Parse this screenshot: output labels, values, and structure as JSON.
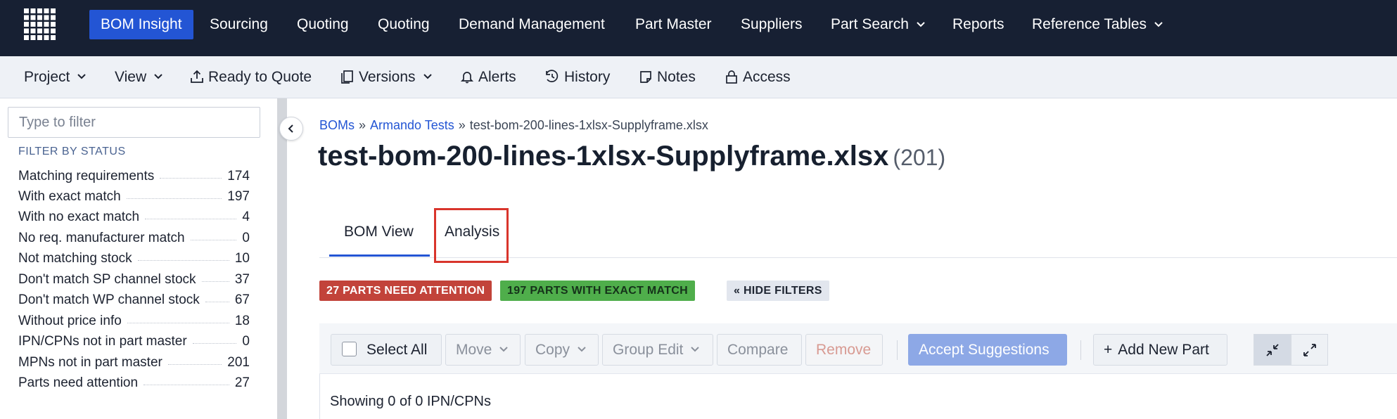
{
  "topnav": {
    "items": [
      {
        "label": "BOM Insight"
      },
      {
        "label": "Sourcing"
      },
      {
        "label": "Quoting"
      },
      {
        "label": "Quoting"
      },
      {
        "label": "Demand Management"
      },
      {
        "label": "Part Master"
      },
      {
        "label": "Suppliers"
      },
      {
        "label": "Part Search"
      },
      {
        "label": "Reports"
      },
      {
        "label": "Reference Tables"
      }
    ],
    "active_index": 0,
    "colors": {
      "bar": "#172033",
      "active": "#2355d4"
    }
  },
  "subbar": {
    "items": [
      {
        "label": "Project",
        "icon": "chevron-down-icon"
      },
      {
        "label": "View",
        "icon": "chevron-down-icon"
      },
      {
        "label": "Ready to Quote",
        "icon": "upload-icon"
      },
      {
        "label": "Versions",
        "icon": "versions-icon"
      },
      {
        "label": "Alerts",
        "icon": "bell-icon"
      },
      {
        "label": "History",
        "icon": "history-icon"
      },
      {
        "label": "Notes",
        "icon": "note-icon"
      },
      {
        "label": "Access",
        "icon": "lock-icon"
      }
    ]
  },
  "sidebar": {
    "filter_placeholder": "Type to filter",
    "filter_value": "",
    "heading": "FILTER BY STATUS",
    "statuses": [
      {
        "label": "Matching requirements",
        "count": "174"
      },
      {
        "label": "With exact match",
        "count": "197"
      },
      {
        "label": "With no exact match",
        "count": "4"
      },
      {
        "label": "No req. manufacturer match",
        "count": "0"
      },
      {
        "label": "Not matching stock",
        "count": "10"
      },
      {
        "label": "Don't match SP channel stock",
        "count": "37"
      },
      {
        "label": "Don't match WP channel stock",
        "count": "67"
      },
      {
        "label": "Without price info",
        "count": "18"
      },
      {
        "label": "IPN/CPNs not in part master",
        "count": "0"
      },
      {
        "label": "MPNs not in part master",
        "count": "201"
      },
      {
        "label": "Parts need attention",
        "count": "27"
      }
    ]
  },
  "breadcrumb": {
    "root": "BOMs",
    "separator": "»",
    "parent": "Armando Tests",
    "current": "test-bom-200-lines-1xlsx-Supplyframe.xlsx"
  },
  "page": {
    "title": "test-bom-200-lines-1xlsx-Supplyframe.xlsx",
    "count": "(201)"
  },
  "tabs": [
    {
      "label": "BOM View",
      "active": true
    },
    {
      "label": "Analysis",
      "active": false,
      "highlighted": true
    }
  ],
  "badges": {
    "attention": "27 PARTS NEED ATTENTION",
    "exact": "197 PARTS WITH EXACT MATCH",
    "hide_filters": "« HIDE FILTERS",
    "colors": {
      "attention": "#c2433a",
      "exact": "#4fae4b"
    }
  },
  "toolbar": {
    "select_all": "Select All",
    "move": "Move",
    "copy": "Copy",
    "group_edit": "Group Edit",
    "compare": "Compare",
    "remove": "Remove",
    "accept_suggestions": "Accept Suggestions",
    "add_new_part": "Add New Part",
    "add_prefix": "+",
    "collapse_icon": "collapse-arrows-icon",
    "expand_icon": "expand-arrows-icon"
  },
  "status_text": "Showing 0 of 0 IPN/CPNs",
  "highlight_color": "#d9352c"
}
